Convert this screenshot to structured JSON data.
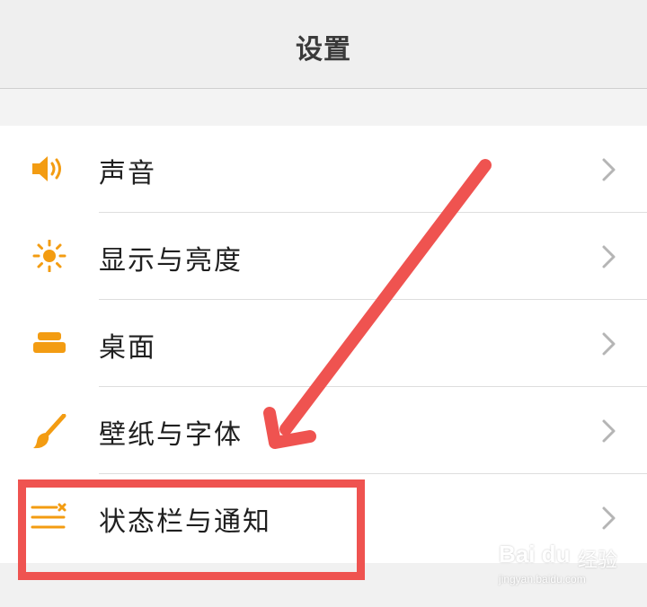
{
  "header": {
    "title": "设置"
  },
  "settings": {
    "items": [
      {
        "label": "声音",
        "icon": "speaker-icon"
      },
      {
        "label": "显示与亮度",
        "icon": "sun-icon"
      },
      {
        "label": "桌面",
        "icon": "desktop-icon"
      },
      {
        "label": "壁纸与字体",
        "icon": "brush-icon"
      },
      {
        "label": "状态栏与通知",
        "icon": "status-bar-icon"
      }
    ]
  },
  "colors": {
    "accent": "#F39C12",
    "annotation": "#EF5350",
    "chevron": "#B5B5B5"
  },
  "watermark": {
    "brand": "Bai du",
    "suffix": "经验",
    "url": "jingyan.baidu.com"
  }
}
